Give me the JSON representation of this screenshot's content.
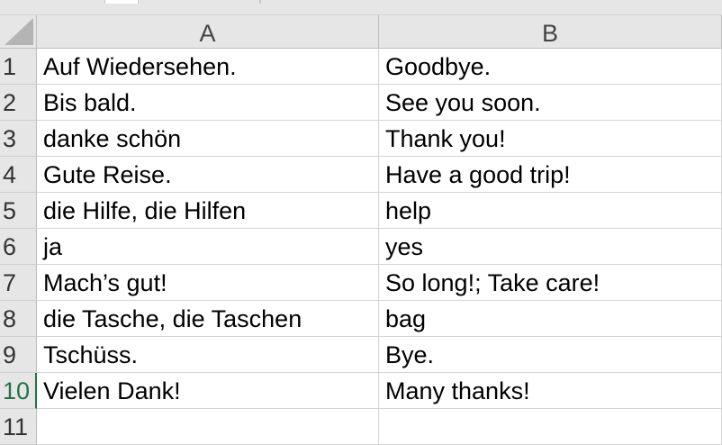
{
  "columns": [
    "A",
    "B"
  ],
  "rows": [
    {
      "num": "1",
      "a": "Auf Wiedersehen.",
      "b": "Goodbye."
    },
    {
      "num": "2",
      "a": "Bis bald.",
      "b": "See you soon."
    },
    {
      "num": "3",
      "a": "danke schön",
      "b": "Thank you!"
    },
    {
      "num": "4",
      "a": "Gute Reise.",
      "b": "Have a good trip!"
    },
    {
      "num": "5",
      "a": "die Hilfe, die Hilfen",
      "b": "help"
    },
    {
      "num": "6",
      "a": "ja",
      "b": "yes"
    },
    {
      "num": "7",
      "a": "Mach’s gut!",
      "b": "So long!; Take care!"
    },
    {
      "num": "8",
      "a": "die Tasche, die Taschen",
      "b": "bag"
    },
    {
      "num": "9",
      "a": "Tschüss.",
      "b": "Bye."
    },
    {
      "num": "10",
      "a": "Vielen Dank!",
      "b": "Many thanks!"
    },
    {
      "num": "11",
      "a": "",
      "b": ""
    }
  ],
  "active_row": "10",
  "colors": {
    "header_bg": "#e6e6e6",
    "gridline": "#d4d4d4",
    "active_accent": "#217346"
  }
}
